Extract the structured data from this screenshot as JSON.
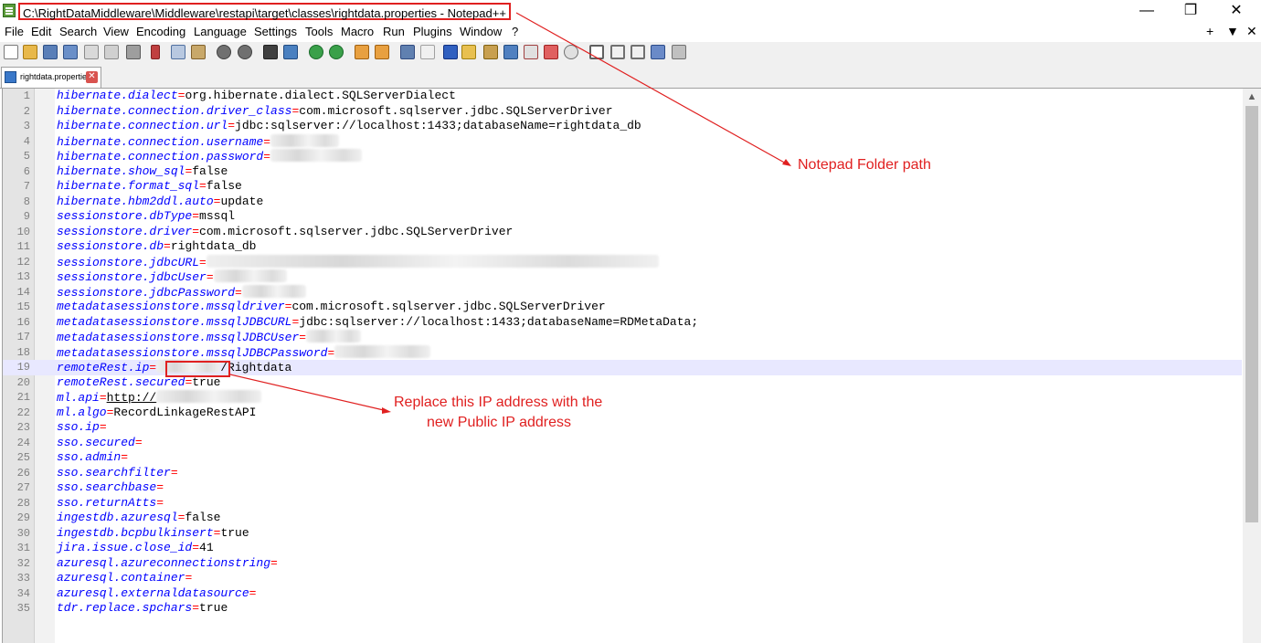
{
  "window": {
    "title": "C:\\RightDataMiddleware\\Middleware\\restapi\\target\\classes\\rightdata.properties - Notepad++",
    "minimize": "—",
    "maximize": "❐",
    "close": "✕"
  },
  "menu": {
    "items": [
      "File",
      "Edit",
      "Search",
      "View",
      "Encoding",
      "Language",
      "Settings",
      "Tools",
      "Macro",
      "Run",
      "Plugins",
      "Window",
      "?"
    ],
    "right": [
      "+",
      "▼",
      "✕"
    ]
  },
  "toolbar": {
    "icons": [
      "new-file-icon",
      "open-icon",
      "save-icon",
      "save-all-icon",
      "close-icon",
      "close-all-icon",
      "print-icon",
      "cut-icon",
      "copy-icon",
      "paste-icon",
      "undo-icon",
      "redo-icon",
      "find-icon",
      "replace-icon",
      "zoom-in-icon",
      "zoom-out-icon",
      "sync-v-icon",
      "sync-h-icon",
      "wrap-icon",
      "all-chars-icon",
      "indent-guide-icon",
      "udl-icon",
      "doc-map-icon",
      "function-list-icon",
      "folder-workspace-icon",
      "monitor-icon",
      "record-macro-icon",
      "stop-macro-icon",
      "play-macro-icon",
      "run-macro-multiple-icon",
      "save-macro-icon"
    ]
  },
  "tab": {
    "label": "rightdata.properties",
    "close": "✕"
  },
  "editor": {
    "current_line": 19,
    "lines": [
      {
        "n": "1",
        "key": "hibernate.dialect",
        "eq": "=",
        "val": "org.hibernate.dialect.SQLServerDialect"
      },
      {
        "n": "2",
        "key": "hibernate.connection.driver_class",
        "eq": "=",
        "val": "com.microsoft.sqlserver.jdbc.SQLServerDriver"
      },
      {
        "n": "3",
        "key": "hibernate.connection.url",
        "eq": "=",
        "val": "jdbc:sqlserver://localhost:1433;databaseName=rightdata_db"
      },
      {
        "n": "4",
        "key": "hibernate.connection.username",
        "eq": "=",
        "val": ""
      },
      {
        "n": "5",
        "key": "hibernate.connection.password",
        "eq": "=",
        "val": ""
      },
      {
        "n": "6",
        "key": "hibernate.show_sql",
        "eq": "=",
        "val": "false"
      },
      {
        "n": "7",
        "key": "hibernate.format_sql",
        "eq": "=",
        "val": "false"
      },
      {
        "n": "8",
        "key": "hibernate.hbm2ddl.auto",
        "eq": "=",
        "val": "update"
      },
      {
        "n": "9",
        "key": "sessionstore.dbType",
        "eq": "=",
        "val": "mssql"
      },
      {
        "n": "10",
        "key": "sessionstore.driver",
        "eq": "=",
        "val": "com.microsoft.sqlserver.jdbc.SQLServerDriver"
      },
      {
        "n": "11",
        "key": "sessionstore.db",
        "eq": "=",
        "val": "rightdata_db"
      },
      {
        "n": "12",
        "key": "sessionstore.jdbcURL",
        "eq": "=",
        "val": ""
      },
      {
        "n": "13",
        "key": "sessionstore.jdbcUser",
        "eq": "=",
        "val": ""
      },
      {
        "n": "14",
        "key": "sessionstore.jdbcPassword",
        "eq": "=",
        "val": ""
      },
      {
        "n": "15",
        "key": "metadatasessionstore.mssqldriver",
        "eq": "=",
        "val": "com.microsoft.sqlserver.jdbc.SQLServerDriver"
      },
      {
        "n": "16",
        "key": "metadatasessionstore.mssqlJDBCURL",
        "eq": "=",
        "val": "jdbc:sqlserver://localhost:1433;databaseName=RDMetaData;"
      },
      {
        "n": "17",
        "key": "metadatasessionstore.mssqlJDBCUser",
        "eq": "=",
        "val": ""
      },
      {
        "n": "18",
        "key": "metadatasessionstore.mssqlJDBCPassword",
        "eq": "=",
        "val": ""
      },
      {
        "n": "19",
        "key": "remoteRest.ip",
        "eq": "=",
        "val": "/Rightdata"
      },
      {
        "n": "20",
        "key": "remoteRest.secured",
        "eq": "=",
        "val": "true"
      },
      {
        "n": "21",
        "key": "ml.api",
        "eq": "=",
        "val": "http://"
      },
      {
        "n": "22",
        "key": "ml.algo",
        "eq": "=",
        "val": "RecordLinkageRestAPI"
      },
      {
        "n": "23",
        "key": "sso.ip",
        "eq": "=",
        "val": ""
      },
      {
        "n": "24",
        "key": "sso.secured",
        "eq": "=",
        "val": ""
      },
      {
        "n": "25",
        "key": "sso.admin",
        "eq": "=",
        "val": ""
      },
      {
        "n": "26",
        "key": "sso.searchfilter",
        "eq": "=",
        "val": ""
      },
      {
        "n": "27",
        "key": "sso.searchbase",
        "eq": "=",
        "val": ""
      },
      {
        "n": "28",
        "key": "sso.returnAtts",
        "eq": "=",
        "val": ""
      },
      {
        "n": "29",
        "key": "ingestdb.azuresql",
        "eq": "=",
        "val": "false"
      },
      {
        "n": "30",
        "key": "ingestdb.bcpbulkinsert",
        "eq": "=",
        "val": "true"
      },
      {
        "n": "31",
        "key": "jira.issue.close_id",
        "eq": "=",
        "val": "41"
      },
      {
        "n": "32",
        "key": "azuresql.azureconnectionstring",
        "eq": "=",
        "val": ""
      },
      {
        "n": "33",
        "key": "azuresql.container",
        "eq": "=",
        "val": ""
      },
      {
        "n": "34",
        "key": "azuresql.externaldatasource",
        "eq": "=",
        "val": ""
      },
      {
        "n": "35",
        "key": "tdr.replace.spchars",
        "eq": "=",
        "val": "true"
      }
    ]
  },
  "annotations": {
    "folder_path": "Notepad Folder path",
    "replace_ip_line1": "Replace this IP address with the",
    "replace_ip_line2": "new Public  IP address"
  },
  "colors": {
    "annotation": "#e02020",
    "key": "#0000ff",
    "operator": "#ff0000",
    "current_line": "#e8e8ff"
  }
}
